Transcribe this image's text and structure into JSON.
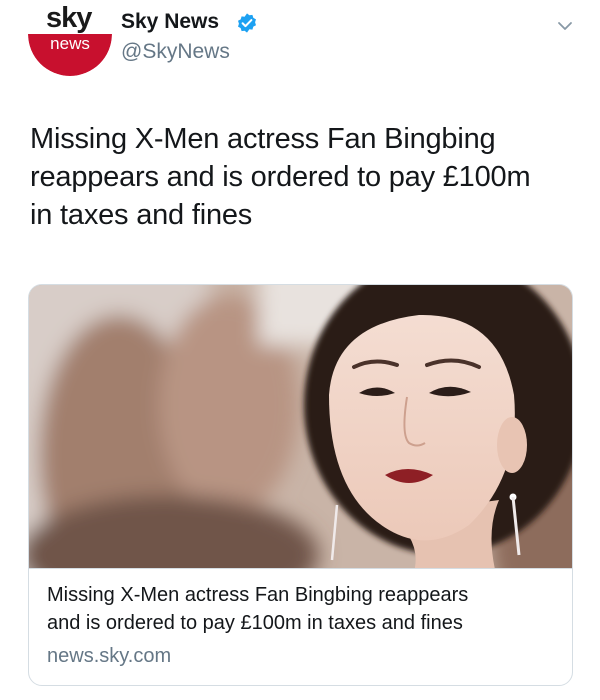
{
  "author": {
    "avatar_logo_text": "sky",
    "avatar_sub_text": "news",
    "name": "Sky News",
    "handle": "@SkyNews"
  },
  "tweet": {
    "text_lines": [
      "Missing X-Men actress Fan Bingbing",
      "reappears and is ordered to pay £100m",
      "in taxes and fines"
    ]
  },
  "card": {
    "title_lines": [
      "Missing X-Men actress Fan Bingbing reappears",
      "and is ordered to pay £100m in taxes and fines"
    ],
    "domain": "news.sky.com"
  },
  "icons": {
    "verified": "verified-badge-icon",
    "menu": "chevron-down-icon"
  },
  "colors": {
    "text_primary": "#14171a",
    "text_secondary": "#657786",
    "verified_blue": "#1da1f2",
    "sky_red": "#c8102e",
    "card_border": "#d5dde3"
  }
}
